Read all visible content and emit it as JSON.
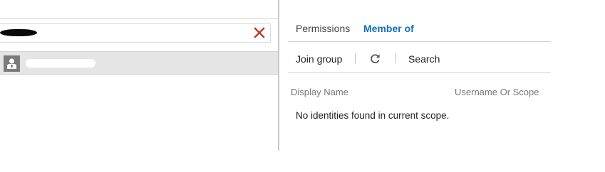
{
  "left_pane": {
    "search_value": "",
    "clear_icon": "close-x-icon",
    "clear_color": "#c0392b",
    "selected_result": {
      "avatar_icon": "user-avatar-icon",
      "name": ""
    }
  },
  "right_pane": {
    "tabs": [
      {
        "label": "Permissions",
        "active": false
      },
      {
        "label": "Member of",
        "active": true
      }
    ],
    "accent_color": "#106ebe",
    "toolbar": {
      "join_group_label": "Join group",
      "refresh_icon": "refresh-icon",
      "search_label": "Search"
    },
    "table": {
      "columns": [
        "Display Name",
        "Username Or Scope"
      ],
      "empty_message": "No identities found in current scope."
    }
  }
}
